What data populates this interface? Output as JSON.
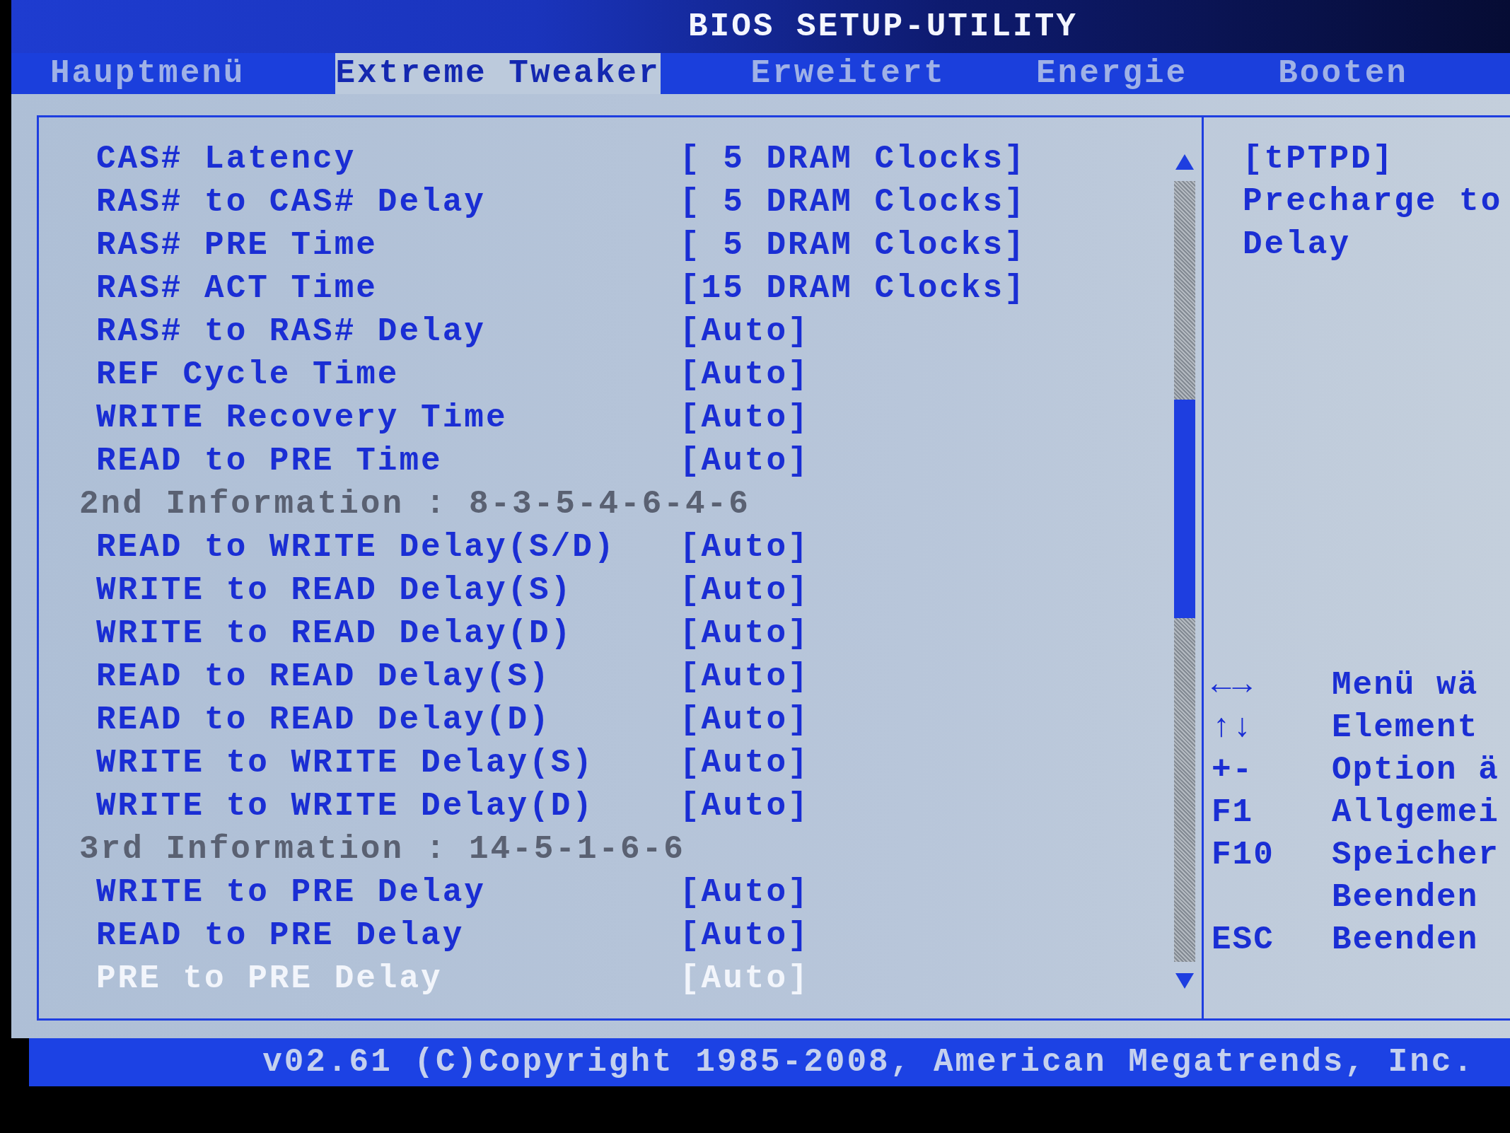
{
  "title": "BIOS SETUP-UTILITY",
  "tabs": [
    {
      "label": "Hauptmenü",
      "selected": false
    },
    {
      "label": "Extreme Tweaker",
      "selected": true
    },
    {
      "label": "Erweitert",
      "selected": false
    },
    {
      "label": "Energie",
      "selected": false
    },
    {
      "label": "Booten",
      "selected": false
    }
  ],
  "settings": [
    {
      "kind": "setting",
      "label": "CAS# Latency",
      "value": "[ 5 DRAM Clocks]",
      "selected": false
    },
    {
      "kind": "setting",
      "label": "RAS# to CAS# Delay",
      "value": "[ 5 DRAM Clocks]",
      "selected": false
    },
    {
      "kind": "setting",
      "label": "RAS# PRE Time",
      "value": "[ 5 DRAM Clocks]",
      "selected": false
    },
    {
      "kind": "setting",
      "label": "RAS# ACT Time",
      "value": "[15 DRAM Clocks]",
      "selected": false
    },
    {
      "kind": "setting",
      "label": "RAS# to RAS# Delay",
      "value": "[Auto]",
      "selected": false
    },
    {
      "kind": "setting",
      "label": "REF Cycle Time",
      "value": "[Auto]",
      "selected": false
    },
    {
      "kind": "setting",
      "label": "WRITE Recovery Time",
      "value": "[Auto]",
      "selected": false
    },
    {
      "kind": "setting",
      "label": "READ to PRE Time",
      "value": "[Auto]",
      "selected": false
    },
    {
      "kind": "info",
      "text": "2nd Information : 8-3-5-4-6-4-6"
    },
    {
      "kind": "setting",
      "label": "READ to WRITE Delay(S/D)",
      "value": "[Auto]",
      "selected": false
    },
    {
      "kind": "setting",
      "label": "WRITE to READ Delay(S)",
      "value": "[Auto]",
      "selected": false
    },
    {
      "kind": "setting",
      "label": "WRITE to READ Delay(D)",
      "value": "[Auto]",
      "selected": false
    },
    {
      "kind": "setting",
      "label": "READ to READ Delay(S)",
      "value": "[Auto]",
      "selected": false
    },
    {
      "kind": "setting",
      "label": "READ to READ Delay(D)",
      "value": "[Auto]",
      "selected": false
    },
    {
      "kind": "setting",
      "label": "WRITE to WRITE Delay(S)",
      "value": "[Auto]",
      "selected": false
    },
    {
      "kind": "setting",
      "label": "WRITE to WRITE Delay(D)",
      "value": "[Auto]",
      "selected": false
    },
    {
      "kind": "info",
      "text": "3rd Information : 14-5-1-6-6"
    },
    {
      "kind": "setting",
      "label": "WRITE to PRE Delay",
      "value": "[Auto]",
      "selected": false
    },
    {
      "kind": "setting",
      "label": "READ to PRE Delay",
      "value": "[Auto]",
      "selected": false
    },
    {
      "kind": "setting",
      "label": "PRE to PRE Delay",
      "value": "[Auto]",
      "selected": true
    }
  ],
  "help": {
    "title": "[tPTPD]",
    "text": "Precharge to Delay"
  },
  "key_legend": [
    {
      "key": "←→",
      "action_lines": [
        "Menü wä"
      ]
    },
    {
      "key": "↑↓",
      "action_lines": [
        "Element"
      ]
    },
    {
      "key": "+-",
      "action_lines": [
        "Option ä"
      ]
    },
    {
      "key": "F1",
      "action_lines": [
        "Allgemei"
      ]
    },
    {
      "key": "F10",
      "action_lines": [
        "Speicher",
        "Beenden"
      ]
    },
    {
      "key": "ESC",
      "action_lines": [
        "Beenden"
      ]
    }
  ],
  "footer": "v02.61 (C)Copyright 1985-2008, American Megatrends, Inc."
}
